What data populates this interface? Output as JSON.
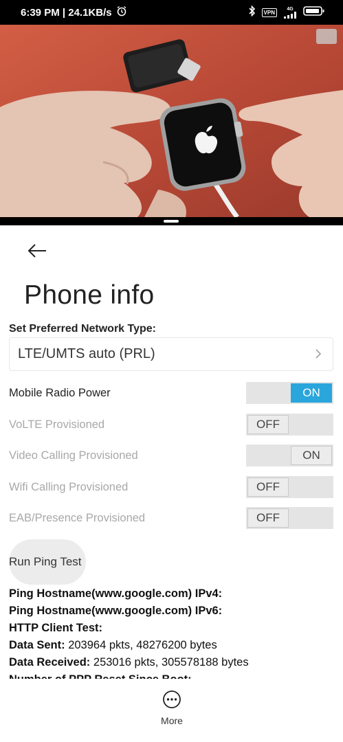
{
  "status_bar": {
    "time_speed": "6:39 PM | 24.1KB/s",
    "vpn": "VPN",
    "network_gen": "4G"
  },
  "page": {
    "title": "Phone info"
  },
  "network": {
    "section_label": "Set Preferred Network Type:",
    "selected": "LTE/UMTS auto (PRL)"
  },
  "toggles": [
    {
      "label": "Mobile Radio Power",
      "state": "ON",
      "enabled": true
    },
    {
      "label": "VoLTE Provisioned",
      "state": "OFF",
      "enabled": false
    },
    {
      "label": "Video Calling Provisioned",
      "state": "ON",
      "enabled": false
    },
    {
      "label": "Wifi Calling Provisioned",
      "state": "OFF",
      "enabled": false
    },
    {
      "label": "EAB/Presence Provisioned",
      "state": "OFF",
      "enabled": false
    }
  ],
  "ping": {
    "button_label": "Run Ping Test"
  },
  "info": [
    {
      "label": "Ping Hostname(www.google.com) IPv4:",
      "value": ""
    },
    {
      "label": "Ping Hostname(www.google.com) IPv6:",
      "value": ""
    },
    {
      "label": "HTTP Client Test:",
      "value": ""
    },
    {
      "label": "Data Sent:",
      "value": " 203964 pkts, 48276200 bytes"
    },
    {
      "label": "Data Received:",
      "value": " 253016 pkts, 305578188 bytes"
    },
    {
      "label": "Number of PPP Reset Since Boot:",
      "value": ""
    }
  ],
  "bottom": {
    "more_label": "More"
  }
}
